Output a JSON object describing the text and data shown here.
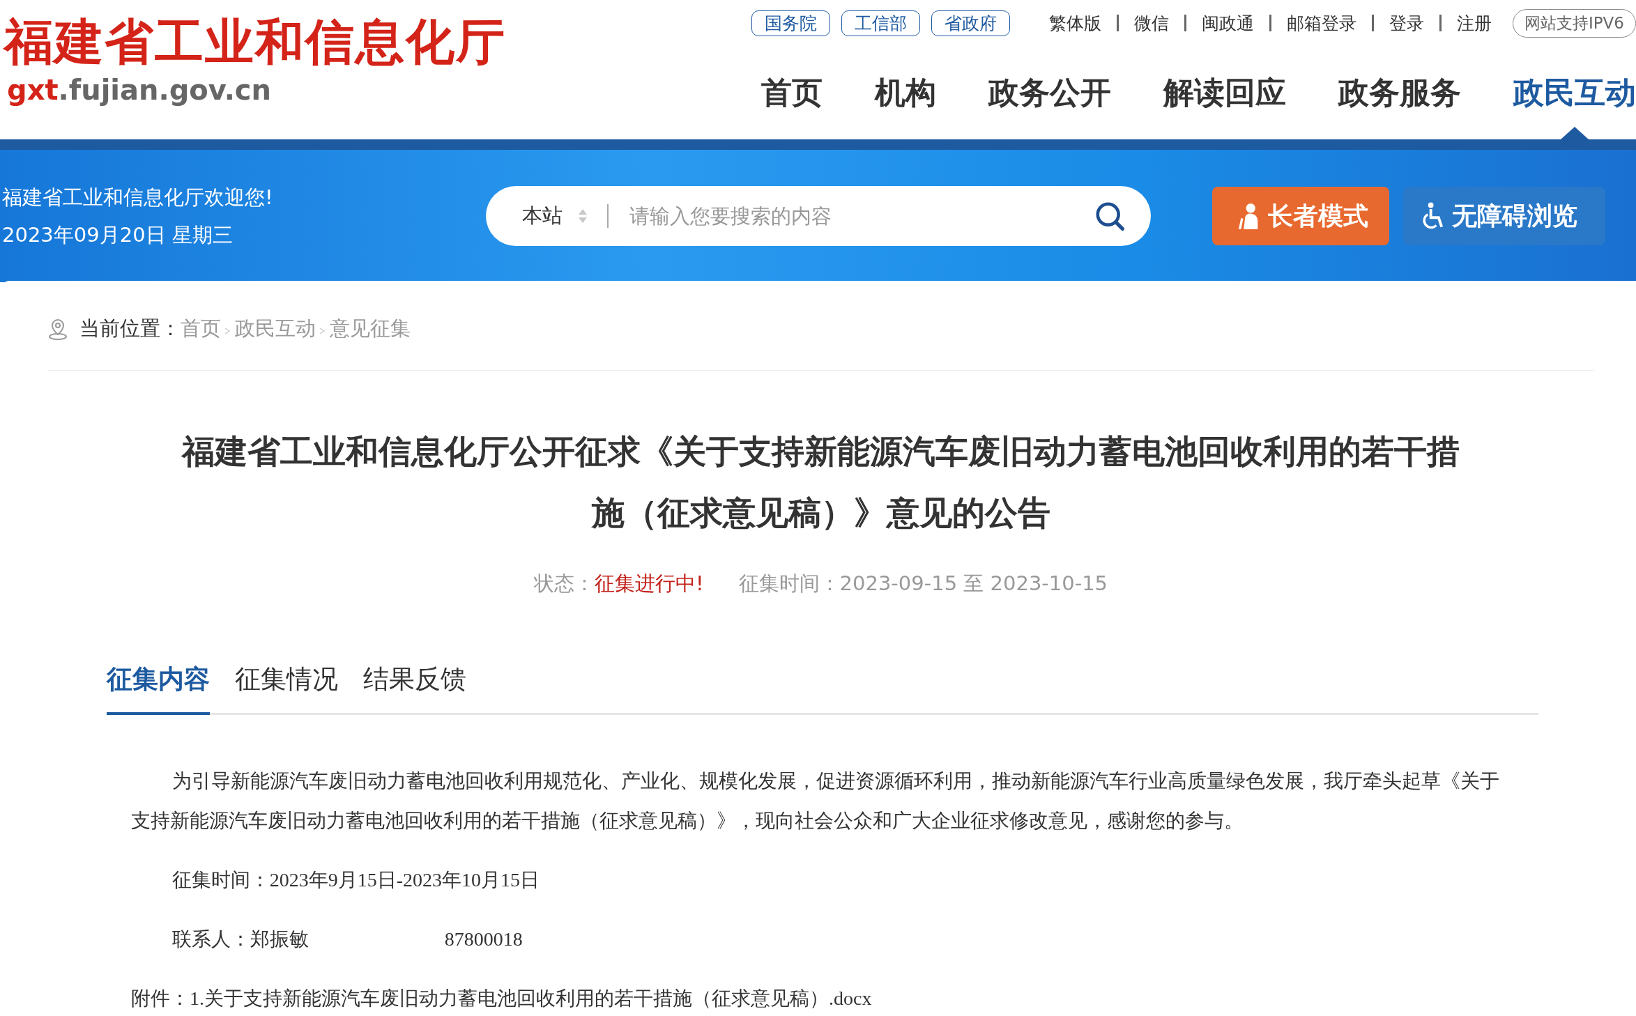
{
  "logo": {
    "title": "福建省工业和信息化厅",
    "domain": [
      {
        "text": "gxt",
        "kind": "accent"
      },
      {
        "text": ".fujian.gov.cn",
        "kind": "plain"
      }
    ]
  },
  "gov_links": [
    "国务院",
    "工信部",
    "省政府"
  ],
  "util_links": [
    "繁体版",
    "微信",
    "闽政通",
    "邮箱登录",
    "登录",
    "注册"
  ],
  "ipv6_badge": "网站支持IPV6",
  "nav": [
    {
      "label": "首页",
      "selected": false
    },
    {
      "label": "机构",
      "selected": false
    },
    {
      "label": "政务公开",
      "selected": false
    },
    {
      "label": "解读回应",
      "selected": false
    },
    {
      "label": "政务服务",
      "selected": false
    },
    {
      "label": "政民互动",
      "selected": true
    }
  ],
  "banner": {
    "welcome": "福建省工业和信息化厅欢迎您!",
    "date": "2023年09月20日 星期三"
  },
  "search": {
    "scope": "本站",
    "placeholder": "请输入您要搜索的内容"
  },
  "mode_buttons": [
    {
      "label": "长者模式",
      "kind": "elder"
    },
    {
      "label": "无障碍浏览",
      "kind": "accessible"
    }
  ],
  "breadcrumb": {
    "label": "当前位置：",
    "items": [
      "首页",
      "政民互动",
      "意见征集"
    ]
  },
  "article": {
    "title": "福建省工业和信息化厅公开征求《关于支持新能源汽车废旧动力蓄电池回收利用的若干措施（征求意见稿）》意见的公告",
    "status_label": "状态：",
    "status": "征集进行中!",
    "period_label": "征集时间：",
    "period": "2023-09-15 至 2023-10-15"
  },
  "tabs": [
    {
      "label": "征集内容",
      "selected": true
    },
    {
      "label": "征集情况",
      "selected": false
    },
    {
      "label": "结果反馈",
      "selected": false
    }
  ],
  "content": [
    {
      "kind": "indent",
      "text": "为引导新能源汽车废旧动力蓄电池回收利用规范化、产业化、规模化发展，促进资源循环利用，推动新能源汽车行业高质量绿色发展，我厅牵头起草《关于支持新能源汽车废旧动力蓄电池回收利用的若干措施（征求意见稿）》，现向社会公众和广大企业征求修改意见，感谢您的参与。"
    },
    {
      "kind": "indent",
      "text": "征集时间：2023年9月15日-2023年10月15日"
    },
    {
      "kind": "contact",
      "text": "联系人：郑振敏",
      "phone": "87800018"
    },
    {
      "kind": "plain",
      "text": "附件：1.关于支持新能源汽车废旧动力蓄电池回收利用的若干措施（征求意见稿）.docx"
    }
  ]
}
